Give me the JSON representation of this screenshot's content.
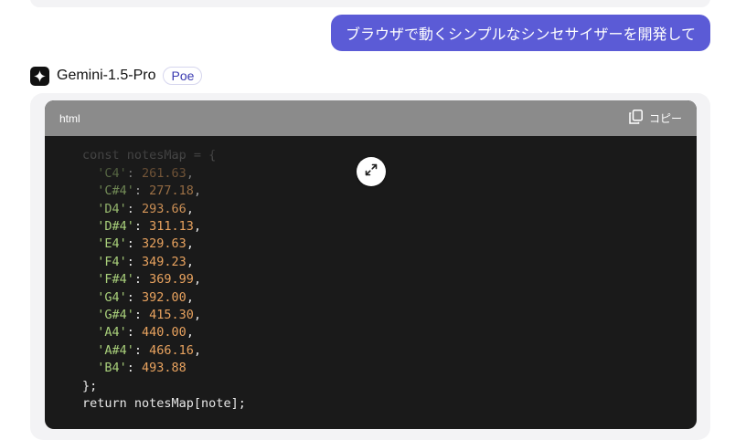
{
  "user_message": "ブラウザで動くシンプルなシンセサイザーを開発して",
  "bot": {
    "name": "Gemini-1.5-Pro",
    "badge": "Poe"
  },
  "code_block": {
    "language": "html",
    "copy_label": "コピー",
    "lines": [
      {
        "indent": "",
        "tokens": [
          {
            "t": "",
            "c": "punc"
          }
        ]
      },
      {
        "indent": "",
        "tokens": [
          {
            "t": "const notesMap = {",
            "c": "kw"
          }
        ]
      },
      {
        "indent": "  ",
        "tokens": [
          {
            "t": "'C4'",
            "c": "key"
          },
          {
            "t": ": ",
            "c": "punc"
          },
          {
            "t": "261.63",
            "c": "num"
          },
          {
            "t": ",",
            "c": "punc"
          }
        ]
      },
      {
        "indent": "  ",
        "tokens": [
          {
            "t": "'C#4'",
            "c": "key"
          },
          {
            "t": ": ",
            "c": "punc"
          },
          {
            "t": "277.18",
            "c": "num"
          },
          {
            "t": ",",
            "c": "punc"
          }
        ]
      },
      {
        "indent": "  ",
        "tokens": [
          {
            "t": "'D4'",
            "c": "key"
          },
          {
            "t": ": ",
            "c": "punc"
          },
          {
            "t": "293.66",
            "c": "num"
          },
          {
            "t": ",",
            "c": "punc"
          }
        ]
      },
      {
        "indent": "  ",
        "tokens": [
          {
            "t": "'D#4'",
            "c": "key"
          },
          {
            "t": ": ",
            "c": "punc"
          },
          {
            "t": "311.13",
            "c": "num"
          },
          {
            "t": ",",
            "c": "punc"
          }
        ]
      },
      {
        "indent": "  ",
        "tokens": [
          {
            "t": "'E4'",
            "c": "key"
          },
          {
            "t": ": ",
            "c": "punc"
          },
          {
            "t": "329.63",
            "c": "num"
          },
          {
            "t": ",",
            "c": "punc"
          }
        ]
      },
      {
        "indent": "  ",
        "tokens": [
          {
            "t": "'F4'",
            "c": "key"
          },
          {
            "t": ": ",
            "c": "punc"
          },
          {
            "t": "349.23",
            "c": "num"
          },
          {
            "t": ",",
            "c": "punc"
          }
        ]
      },
      {
        "indent": "  ",
        "tokens": [
          {
            "t": "'F#4'",
            "c": "key"
          },
          {
            "t": ": ",
            "c": "punc"
          },
          {
            "t": "369.99",
            "c": "num"
          },
          {
            "t": ",",
            "c": "punc"
          }
        ]
      },
      {
        "indent": "  ",
        "tokens": [
          {
            "t": "'G4'",
            "c": "key"
          },
          {
            "t": ": ",
            "c": "punc"
          },
          {
            "t": "392.00",
            "c": "num"
          },
          {
            "t": ",",
            "c": "punc"
          }
        ]
      },
      {
        "indent": "  ",
        "tokens": [
          {
            "t": "'G#4'",
            "c": "key"
          },
          {
            "t": ": ",
            "c": "punc"
          },
          {
            "t": "415.30",
            "c": "num"
          },
          {
            "t": ",",
            "c": "punc"
          }
        ]
      },
      {
        "indent": "  ",
        "tokens": [
          {
            "t": "'A4'",
            "c": "key"
          },
          {
            "t": ": ",
            "c": "punc"
          },
          {
            "t": "440.00",
            "c": "num"
          },
          {
            "t": ",",
            "c": "punc"
          }
        ]
      },
      {
        "indent": "  ",
        "tokens": [
          {
            "t": "'A#4'",
            "c": "key"
          },
          {
            "t": ": ",
            "c": "punc"
          },
          {
            "t": "466.16",
            "c": "num"
          },
          {
            "t": ",",
            "c": "punc"
          }
        ]
      },
      {
        "indent": "  ",
        "tokens": [
          {
            "t": "'B4'",
            "c": "key"
          },
          {
            "t": ": ",
            "c": "punc"
          },
          {
            "t": "493.88",
            "c": "num"
          }
        ]
      },
      {
        "indent": "",
        "tokens": [
          {
            "t": "};",
            "c": "punc"
          }
        ]
      },
      {
        "indent": "",
        "tokens": [
          {
            "t": "return",
            "c": "kw"
          },
          {
            "t": " notesMap[note];",
            "c": "punc"
          }
        ]
      }
    ]
  },
  "icons": {
    "bot_avatar": "sparkle-icon",
    "copy": "copy-icon",
    "expand": "expand-icon"
  },
  "colors": {
    "user_bubble": "#5b5bd6",
    "code_bg": "#1a1a1a",
    "code_header": "#8b8b8b",
    "string": "#a8cf7a",
    "number": "#e9a35f"
  }
}
